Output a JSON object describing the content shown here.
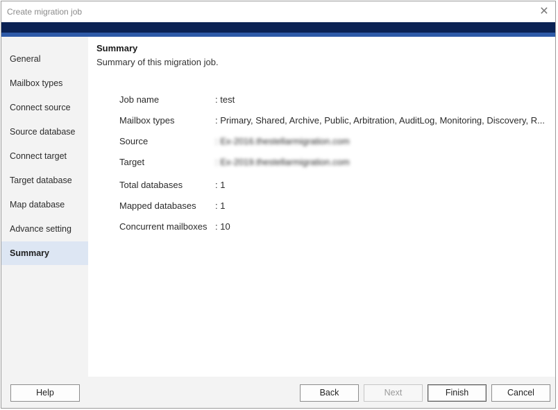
{
  "window": {
    "title": "Create migration job",
    "close_icon": "close-icon",
    "colors": {
      "header_band": "#0b2254",
      "header_stripe": "#2e5aa8",
      "active_nav": "#dde6f3"
    }
  },
  "sidebar": {
    "items": [
      {
        "label": "General"
      },
      {
        "label": "Mailbox types"
      },
      {
        "label": "Connect source"
      },
      {
        "label": "Source database"
      },
      {
        "label": "Connect target"
      },
      {
        "label": "Target database"
      },
      {
        "label": "Map database"
      },
      {
        "label": "Advance setting"
      },
      {
        "label": "Summary",
        "active": true
      }
    ]
  },
  "main": {
    "heading": "Summary",
    "subheading": "Summary of this migration job.",
    "fields": [
      {
        "label": "Job name",
        "value": ": test"
      },
      {
        "label": "Mailbox types",
        "value": ": Primary, Shared, Archive, Public, Arbitration, AuditLog, Monitoring, Discovery, R..."
      },
      {
        "label": "Source",
        "value": ": Ex-2016.thestellarmigration.com",
        "blurred": true
      },
      {
        "label": "Target",
        "value": ": Ex-2019.thestellarmigration.com",
        "blurred": true
      },
      {
        "label": "Total databases",
        "value": ": 1"
      },
      {
        "label": "Mapped databases",
        "value": ": 1"
      },
      {
        "label": "Concurrent mailboxes",
        "value": ": 10"
      }
    ]
  },
  "footer": {
    "help": "Help",
    "back": "Back",
    "next": "Next",
    "finish": "Finish",
    "cancel": "Cancel"
  }
}
